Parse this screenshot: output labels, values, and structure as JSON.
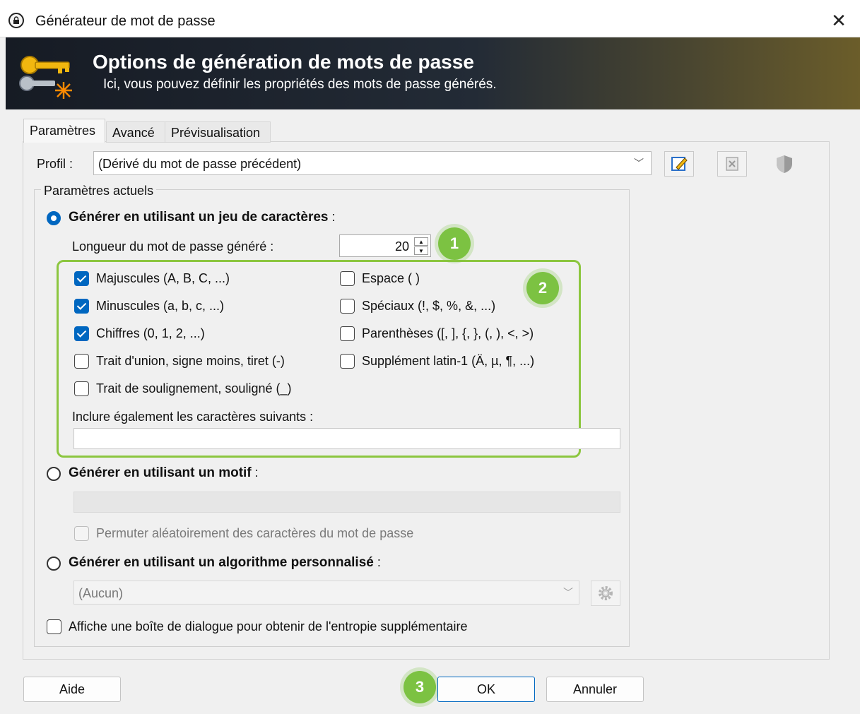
{
  "window": {
    "title": "Générateur de mot de passe",
    "close_glyph": "✕"
  },
  "banner": {
    "title": "Options de génération de mots de passe",
    "subtitle": "Ici, vous pouvez définir les propriétés des mots de passe générés."
  },
  "tabs": [
    {
      "label": "Paramètres",
      "selected": true
    },
    {
      "label": "Avancé",
      "selected": false
    },
    {
      "label": "Prévisualisation",
      "selected": false
    }
  ],
  "profile": {
    "label": "Profil :",
    "value": "(Dérivé du mot de passe précédent)",
    "buttons": [
      "edit-profile-icon",
      "delete-profile-icon",
      "shield-icon"
    ]
  },
  "group": {
    "legend": "Paramètres actuels"
  },
  "charset_mode": {
    "label": "Générer en utilisant un jeu de caractères",
    "suffix": " :",
    "selected": true,
    "length_label": "Longueur du mot de passe généré :",
    "length_value": "20",
    "options_left": [
      {
        "label": "Majuscules (A, B, C, ...)",
        "checked": true
      },
      {
        "label": "Minuscules (a, b, c, ...)",
        "checked": true
      },
      {
        "label": "Chiffres (0, 1, 2, ...)",
        "checked": true
      },
      {
        "label": "Trait d'union, signe moins, tiret (-)",
        "checked": false
      },
      {
        "label": "Trait de soulignement, souligné (_)",
        "checked": false
      }
    ],
    "options_right": [
      {
        "label": "Espace ( )",
        "checked": false
      },
      {
        "label": "Spéciaux (!, $, %, &, ...)",
        "checked": false
      },
      {
        "label": "Parenthèses ([, ], {, }, (, ), <, >)",
        "checked": false
      },
      {
        "label": "Supplément latin-1  (Ä, µ, ¶, ...)",
        "checked": false
      }
    ],
    "include_label": "Inclure également les caractères suivants :",
    "include_value": ""
  },
  "pattern_mode": {
    "label": "Générer en utilisant un motif",
    "suffix": " :",
    "selected": false,
    "pattern_value": "",
    "shuffle_label": "Permuter aléatoirement des caractères du mot de passe",
    "shuffle_checked": false
  },
  "algo_mode": {
    "label": "Générer en utilisant un algorithme personnalisé",
    "suffix": " :",
    "selected": false,
    "algo_value": "(Aucun)"
  },
  "entropy": {
    "label": "Affiche une boîte de dialogue pour obtenir de l'entropie supplémentaire",
    "checked": false
  },
  "buttons": {
    "help": "Aide",
    "ok": "OK",
    "cancel": "Annuler"
  },
  "badges": [
    "1",
    "2",
    "3"
  ],
  "colors": {
    "accent": "#0067c0",
    "highlight": "#8cc63f",
    "badge": "#7cc242"
  }
}
